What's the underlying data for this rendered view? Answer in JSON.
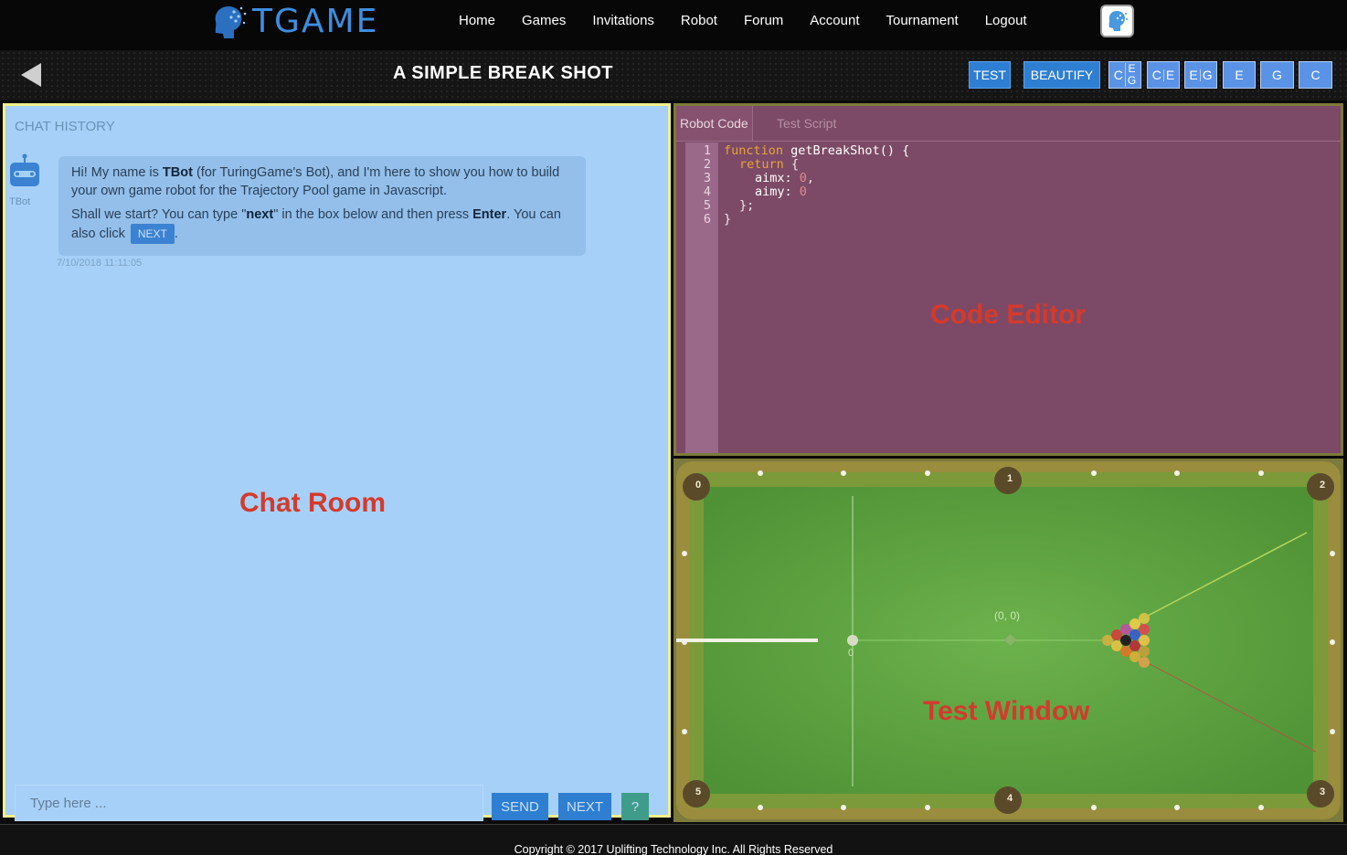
{
  "brand": {
    "logo_text": "TGAME"
  },
  "nav": {
    "items": [
      {
        "label": "Home"
      },
      {
        "label": "Games"
      },
      {
        "label": "Invitations"
      },
      {
        "label": "Robot"
      },
      {
        "label": "Forum"
      },
      {
        "label": "Account"
      },
      {
        "label": "Tournament"
      },
      {
        "label": "Logout"
      }
    ]
  },
  "titlebar": {
    "title": "A SIMPLE BREAK SHOT",
    "test_label": "TEST",
    "beautify_label": "BEAUTIFY",
    "pills": [
      "C",
      "E",
      "G",
      "C",
      "E",
      "E",
      "G",
      "E",
      "G",
      "C"
    ]
  },
  "chat": {
    "history_label": "CHAT HISTORY",
    "bot_name": "TBot",
    "message": {
      "p1_a": "Hi! My name is ",
      "p1_bold": "TBot",
      "p1_b": " (for TuringGame's Bot), and I'm here to show you how to build your own game robot for the Trajectory Pool game in Javascript.",
      "p2_a": "Shall we start? You can type \"",
      "p2_bold1": "next",
      "p2_b": "\" in the box below and then press ",
      "p2_bold2": "Enter",
      "p2_c": ". You can also click ",
      "p2_btn": "NEXT",
      "p2_d": "."
    },
    "timestamp": "7/10/2018 11:11:05",
    "overlay_label": "Chat Room",
    "input_placeholder": "Type here ...",
    "send_label": "SEND",
    "next_label": "NEXT",
    "help_label": "?"
  },
  "editor": {
    "tabs": [
      "Robot Code",
      "Test Script"
    ],
    "line_numbers": [
      "1",
      "2",
      "3",
      "4",
      "5",
      "6"
    ],
    "code": {
      "l1_kw": "function",
      "l1_rest": " getBreakShot() {",
      "l2_kw": "return",
      "l2_rest": " {",
      "l3_key": "aimx:",
      "l3_val": " 0",
      "l3_tail": ",",
      "l4_key": "aimy:",
      "l4_val": " 0",
      "l5": "};",
      "l6": "}"
    },
    "overlay_label": "Code Editor"
  },
  "test_window": {
    "pocket_labels": [
      "0",
      "1",
      "2",
      "3",
      "4",
      "5"
    ],
    "origin_label": "(0, 0)",
    "cue_ball_label": "0",
    "overlay_label": "Test Window"
  },
  "footer": {
    "copyright": "Copyright © 2017 Uplifting Technology Inc. All Rights Reserved"
  },
  "colors": {
    "chat_bg": "#a6d0f7",
    "editor_bg": "#7c4a66",
    "table_felt": "#5fa342",
    "overlay_label": "#d43a2c",
    "button_blue": "#2e7ed2"
  }
}
